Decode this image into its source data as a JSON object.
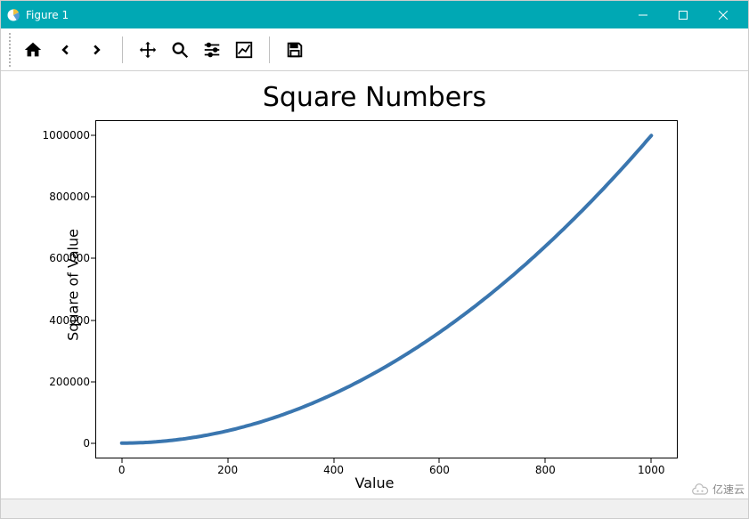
{
  "window": {
    "title": "Figure 1",
    "minimize_label": "Minimize",
    "maximize_label": "Maximize",
    "close_label": "Close"
  },
  "toolbar": {
    "home": "Home",
    "back": "Back",
    "forward": "Forward",
    "pan": "Pan",
    "zoom": "Zoom",
    "subplots": "Configure subplots",
    "axes": "Edit axis",
    "save": "Save"
  },
  "chart_data": {
    "type": "line",
    "title": "Square Numbers",
    "xlabel": "Value",
    "ylabel": "Square of Value",
    "x": [
      0,
      100,
      200,
      300,
      400,
      500,
      600,
      700,
      800,
      900,
      1000
    ],
    "y": [
      0,
      10000,
      40000,
      90000,
      160000,
      250000,
      360000,
      490000,
      640000,
      810000,
      1000000
    ],
    "xticks": [
      0,
      200,
      400,
      600,
      800,
      1000
    ],
    "yticks": [
      0,
      200000,
      400000,
      600000,
      800000,
      1000000
    ],
    "xlim": [
      -50,
      1050
    ],
    "ylim": [
      -50000,
      1050000
    ],
    "line_color": "#3a76af",
    "line_width": 4
  },
  "watermark": "亿速云"
}
